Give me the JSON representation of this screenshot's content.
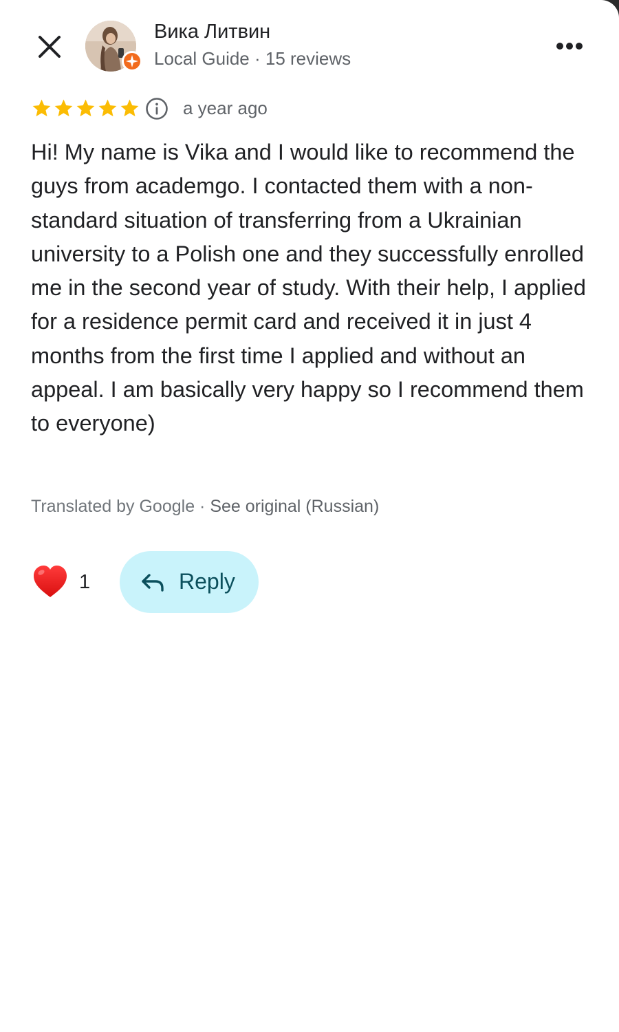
{
  "header": {
    "close_icon": "close-icon",
    "more_icon": "more-horizontal-icon",
    "avatar_icon": "profile-photo",
    "badge_icon": "local-guide-badge-icon",
    "badge_color": "#f26b1d"
  },
  "author": {
    "name": "Вика Литвин",
    "meta": "Local Guide · 15 reviews"
  },
  "review": {
    "rating": 5,
    "rating_max": 5,
    "star_color": "#fbbc04",
    "info_icon": "info-icon",
    "time": "a year ago",
    "text": "Hi! My name is Vika and I would like to recommend the guys from academgo. I contacted them with a non-standard situation of transferring from a Ukrainian university to a Polish one and they successfully enrolled me in the second year of study. With their help, I applied for a residence permit card and received it in just 4 months from the first time I applied and without an appeal. I am basically very happy so I recommend them to everyone)"
  },
  "translation": {
    "translated_by": "Translated by Google",
    "separator": " · ",
    "see_original": "See original (Russian)"
  },
  "actions": {
    "like_icon": "heart-icon",
    "like_count": "1",
    "reply_icon": "reply-arrow-icon",
    "reply_label": "Reply",
    "reply_bg": "#c9f3fb"
  }
}
